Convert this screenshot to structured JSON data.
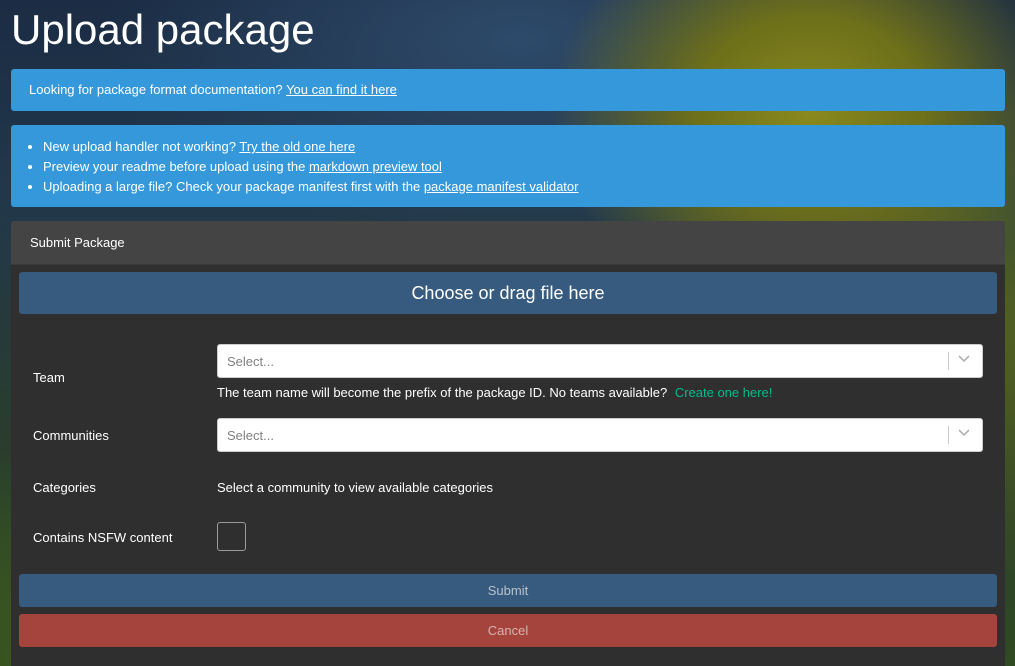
{
  "page": {
    "title": "Upload package"
  },
  "docs_alert": {
    "text": "Looking for package format documentation?",
    "link": "You can find it here"
  },
  "tips_alert": {
    "items": [
      {
        "text": "New upload handler not working?",
        "link": "Try the old one here"
      },
      {
        "text": "Preview your readme before upload using the",
        "link": "markdown preview tool"
      },
      {
        "text": "Uploading a large file? Check your package manifest first with the",
        "link": "package manifest validator"
      }
    ]
  },
  "form": {
    "header": "Submit Package",
    "dropzone_label": "Choose or drag file here",
    "team": {
      "label": "Team",
      "placeholder": "Select...",
      "help_text": "The team name will become the prefix of the package ID. No teams available?",
      "help_link": "Create one here!"
    },
    "communities": {
      "label": "Communities",
      "placeholder": "Select..."
    },
    "categories": {
      "label": "Categories",
      "text": "Select a community to view available categories"
    },
    "nsfw": {
      "label": "Contains NSFW content"
    },
    "submit_label": "Submit",
    "cancel_label": "Cancel"
  },
  "colors": {
    "info": "#3498db",
    "primary": "#375a7f",
    "danger": "#a5433d",
    "card": "#2f2f2f",
    "link_green": "#00bc8c"
  }
}
